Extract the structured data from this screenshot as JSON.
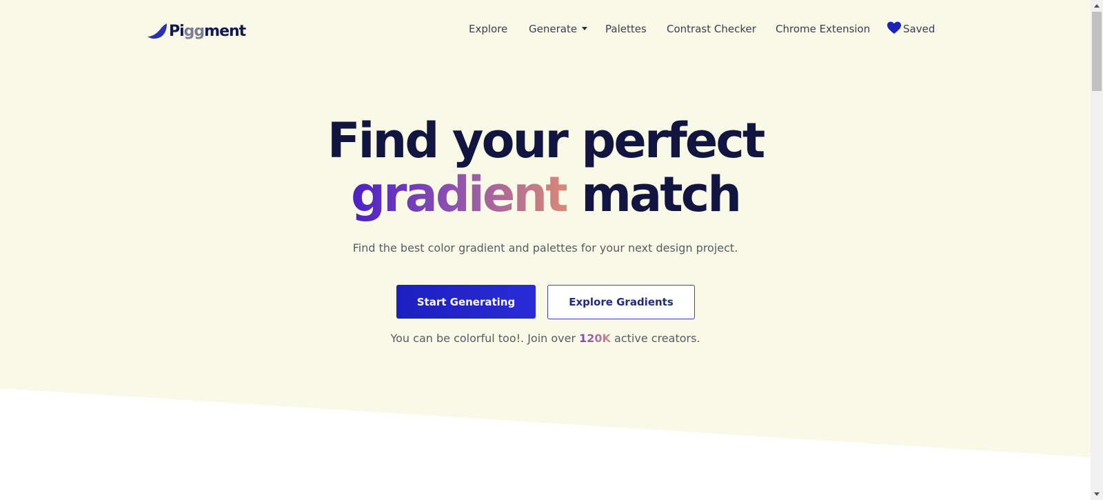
{
  "colors": {
    "hero_bg": "#f8f9e6",
    "page_bg": "#ffffff",
    "brand_primary": "#1c1fc0",
    "heading_text": "#121540",
    "gradient_start": "#4a1fc7",
    "gradient_end": "#d98a78"
  },
  "brand": {
    "name_prefix": "Pi",
    "name_gg": "gg",
    "name_suffix": "ment",
    "logo_icon": "leaf-wave-logo"
  },
  "nav": {
    "items": [
      {
        "label": "Explore"
      },
      {
        "label": "Generate",
        "icon": "caret-down"
      },
      {
        "label": "Palettes"
      },
      {
        "label": "Contrast Checker"
      },
      {
        "label": "Chrome Extension"
      },
      {
        "label": "Saved",
        "icon": "heart"
      }
    ]
  },
  "hero": {
    "headline_line1": "Find your perfect",
    "headline_gradient_word": "gradient",
    "headline_line2_rest": "match",
    "subtitle": "Find the best color gradient and palettes for your next design project.",
    "primary_button": "Start Generating",
    "secondary_button": "Explore Gradients",
    "social_prefix": "You can be colorful too!. Join over",
    "social_count": "120K",
    "social_suffix": "active creators."
  }
}
